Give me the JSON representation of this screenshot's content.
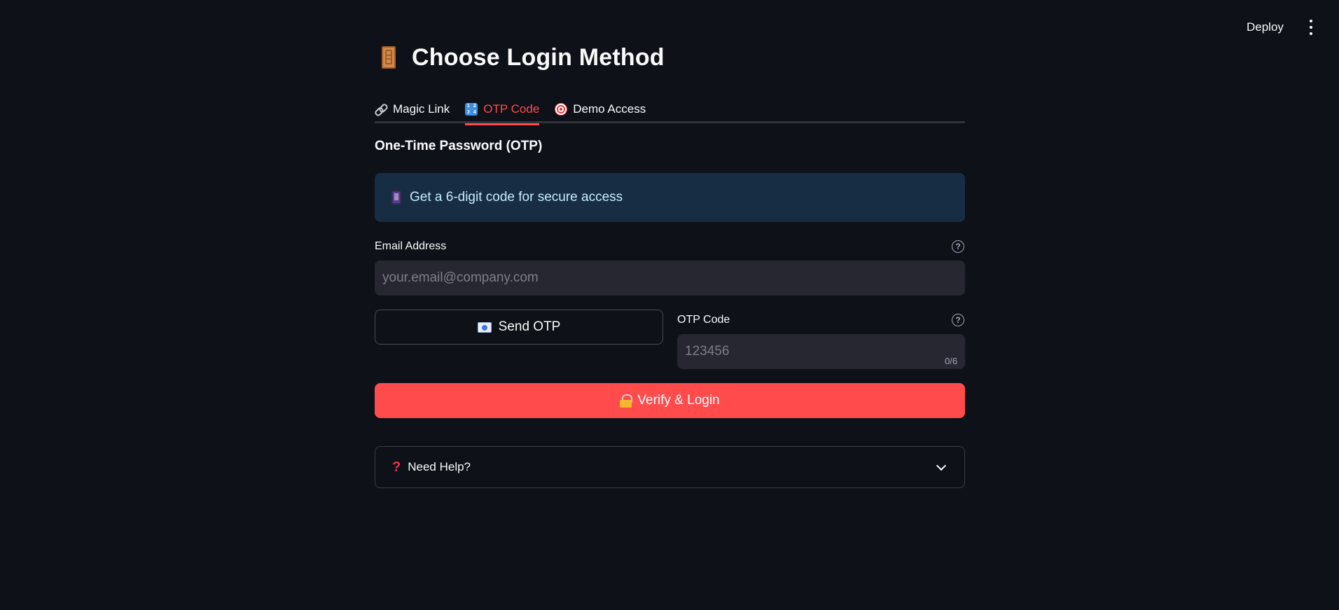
{
  "header": {
    "deploy_label": "Deploy",
    "menu_icon": "kebab-menu-icon"
  },
  "page": {
    "title": "Choose Login Method",
    "title_icon": "door-icon"
  },
  "tabs": [
    {
      "label": "Magic Link",
      "icon": "link-icon",
      "active": false
    },
    {
      "label": "OTP Code",
      "icon": "numpad-icon",
      "active": true
    },
    {
      "label": "Demo Access",
      "icon": "target-icon",
      "active": false
    }
  ],
  "otp": {
    "section_title": "One-Time Password (OTP)",
    "info_text": "Get a 6-digit code for secure access",
    "email_label": "Email Address",
    "email_value": "",
    "email_placeholder": "your.email@company.com",
    "send_button_label": "Send OTP",
    "otp_label": "OTP Code",
    "otp_value": "",
    "otp_placeholder": "123456",
    "otp_counter": "0/6",
    "verify_button_label": "Verify & Login"
  },
  "help": {
    "expander_label": "Need Help?",
    "expanded": false
  },
  "colors": {
    "background": "#0e1117",
    "accent": "#ff4b4b",
    "info_bg": "#172d43",
    "info_text": "#c7ebff",
    "input_bg": "#262730"
  }
}
